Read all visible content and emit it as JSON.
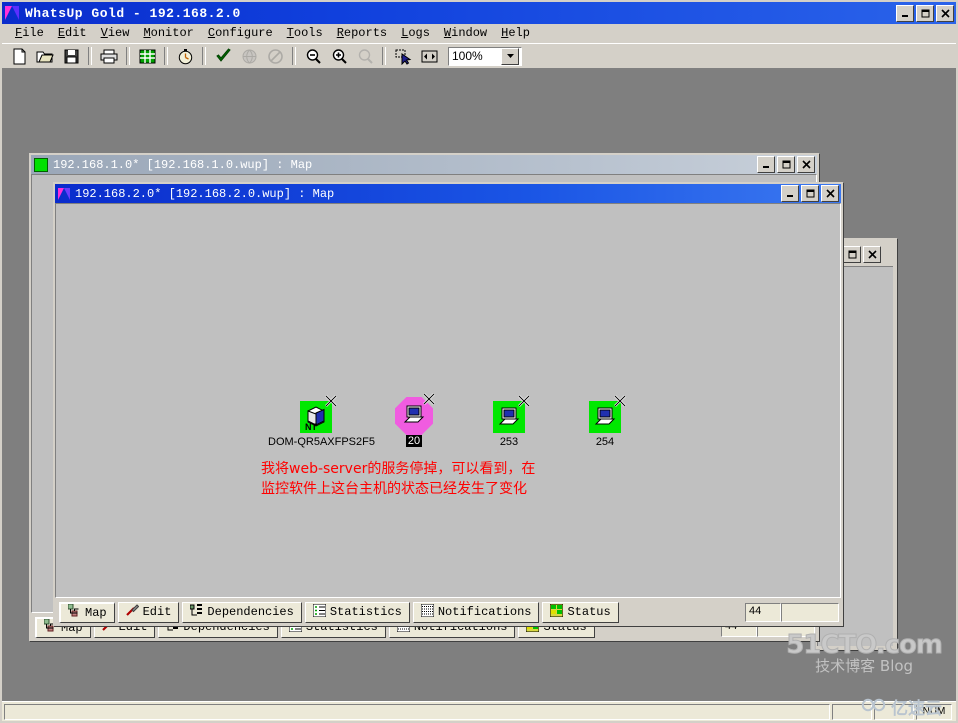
{
  "app": {
    "title": "WhatsUp Gold - 192.168.2.0",
    "logo_icon": "whatsup-logo-icon",
    "window_controls": [
      {
        "name": "minimize-button",
        "glyph": "minimize"
      },
      {
        "name": "maximize-button",
        "glyph": "maximize"
      },
      {
        "name": "close-button",
        "glyph": "close"
      }
    ]
  },
  "menu": {
    "items": [
      {
        "label": "File",
        "accel": "F"
      },
      {
        "label": "Edit",
        "accel": "E"
      },
      {
        "label": "View",
        "accel": "V"
      },
      {
        "label": "Monitor",
        "accel": "M"
      },
      {
        "label": "Configure",
        "accel": "C"
      },
      {
        "label": "Tools",
        "accel": "T"
      },
      {
        "label": "Reports",
        "accel": "R"
      },
      {
        "label": "Logs",
        "accel": "L"
      },
      {
        "label": "Window",
        "accel": "W"
      },
      {
        "label": "Help",
        "accel": "H"
      }
    ]
  },
  "toolbar": {
    "buttons": [
      {
        "name": "new-map-button",
        "icon": "new-document-icon",
        "enabled": true
      },
      {
        "name": "open-map-button",
        "icon": "open-folder-icon",
        "enabled": true
      },
      {
        "name": "save-map-button",
        "icon": "floppy-save-icon",
        "enabled": true
      },
      {
        "name": "print-button",
        "icon": "printer-icon",
        "enabled": true
      },
      {
        "name": "grid-view-button",
        "icon": "grid-table-icon",
        "enabled": true
      },
      {
        "name": "poll-timer-button",
        "icon": "stopwatch-icon",
        "enabled": true
      },
      {
        "name": "start-monitoring-button",
        "icon": "green-check-icon",
        "enabled": true
      },
      {
        "name": "web-button",
        "icon": "globe-icon",
        "enabled": false
      },
      {
        "name": "stop-monitoring-button",
        "icon": "no-entry-icon",
        "enabled": false
      },
      {
        "name": "zoom-out-button",
        "icon": "magnifier-minus-icon",
        "enabled": true
      },
      {
        "name": "zoom-in-button",
        "icon": "magnifier-plus-icon",
        "enabled": true
      },
      {
        "name": "zoom-percent-button",
        "icon": "magnifier-percent-icon",
        "enabled": false
      },
      {
        "name": "select-pointer-button",
        "icon": "arrow-pointer-icon",
        "enabled": true
      },
      {
        "name": "fit-width-button",
        "icon": "horizontal-arrows-icon",
        "enabled": true
      }
    ],
    "zoom": {
      "value": "100%",
      "dropdown_icon": "chevron-down-icon"
    }
  },
  "windows": {
    "back": {
      "title": "192.168.1.0* [192.168.1.0.wup] : Map",
      "icon": "green-square-icon",
      "active": false,
      "controls": [
        {
          "name": "minimize-button",
          "glyph": "minimize"
        },
        {
          "name": "maximize-button",
          "glyph": "maximize"
        },
        {
          "name": "close-button",
          "glyph": "close"
        }
      ]
    },
    "front": {
      "title": "192.168.2.0* [192.168.2.0.wup] : Map",
      "icon": "magenta-triangle-icon",
      "active": true,
      "controls": [
        {
          "name": "minimize-button",
          "glyph": "minimize"
        },
        {
          "name": "maximize-button",
          "glyph": "maximize"
        },
        {
          "name": "close-button",
          "glyph": "close"
        }
      ]
    },
    "hidden": {
      "controls": [
        {
          "name": "restore-button",
          "glyph": "maximize"
        },
        {
          "name": "close-button",
          "glyph": "close"
        }
      ]
    }
  },
  "map": {
    "devices": [
      {
        "label": "DOM-QR5AXFPS2F5",
        "state": "up",
        "shape": "square",
        "color": "#00e800",
        "badge": "NT",
        "icon": "server-tower-icon",
        "selected": false
      },
      {
        "label": "20",
        "state": "down",
        "shape": "octagon",
        "color": "#f05ce0",
        "badge": "",
        "icon": "workstation-icon",
        "selected": true
      },
      {
        "label": "253",
        "state": "up",
        "shape": "square",
        "color": "#00e800",
        "badge": "",
        "icon": "workstation-icon",
        "selected": false
      },
      {
        "label": "254",
        "state": "up",
        "shape": "square",
        "color": "#00e800",
        "badge": "",
        "icon": "workstation-icon",
        "selected": false
      }
    ],
    "annotation": {
      "color": "#ff0000",
      "line1": "我将web-server的服务停掉，可以看到，在",
      "line2": "监控软件上这台主机的状态已经发生了变化"
    }
  },
  "tabs": {
    "items": [
      {
        "label": "Map",
        "icon": "network-map-icon",
        "active": true
      },
      {
        "label": "Edit",
        "icon": "wrench-screwdriver-icon",
        "active": false
      },
      {
        "label": "Dependencies",
        "icon": "tree-list-icon",
        "active": false
      },
      {
        "label": "Statistics",
        "icon": "statistics-list-icon",
        "active": false
      },
      {
        "label": "Notifications",
        "icon": "notifications-list-icon",
        "active": false
      },
      {
        "label": "Status",
        "icon": "status-grid-icon",
        "active": false
      }
    ],
    "counter": "44",
    "extra_field": ""
  },
  "statusbar": {
    "message": "",
    "indicators": [
      {
        "name": "num-lock-indicator",
        "label": "NUM"
      }
    ]
  },
  "watermarks": {
    "site_name": "51CTO.com",
    "site_sub_cn": "技术博客",
    "site_sub_en": "Blog",
    "cloud_name": "亿速云",
    "cloud_icon": "cloud-logo-icon"
  }
}
